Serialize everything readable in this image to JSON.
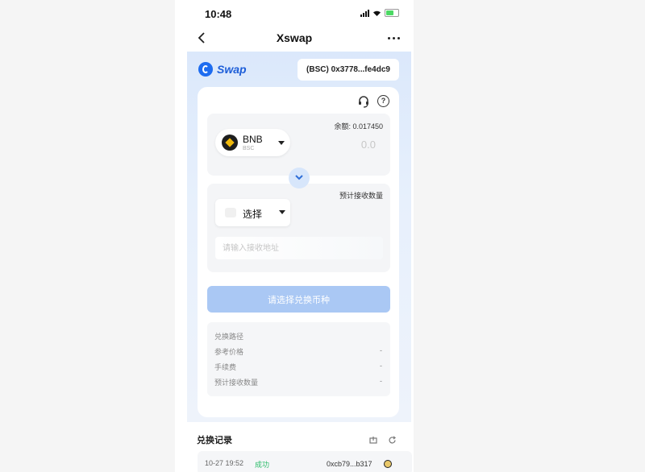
{
  "status_bar": {
    "time": "10:48"
  },
  "nav": {
    "title": "Xswap"
  },
  "header": {
    "brand": "Swap",
    "address": "(BSC) 0x3778...fe4dc9",
    "brand_color": "#1d5ed8"
  },
  "from": {
    "balance_label": "余额: 0.017450",
    "token": "BNB",
    "chain": "BSC",
    "amount": "0.0"
  },
  "to": {
    "estimate_label": "预计接收数量",
    "token_placeholder": "选择",
    "address_placeholder": "请输入接收地址"
  },
  "action": {
    "label": "请选择兑换币种",
    "color": "#aac8f4"
  },
  "info": {
    "rows": [
      {
        "label": "兑换路径",
        "value": ""
      },
      {
        "label": "参考价格",
        "value": "-"
      },
      {
        "label": "手续费",
        "value": "-"
      },
      {
        "label": "预计接收数量",
        "value": "-"
      }
    ]
  },
  "history": {
    "title": "兑换记录",
    "rows": [
      {
        "time": "10-27 19:52",
        "status": "成功",
        "hash": "0xcb79...b317"
      }
    ],
    "success_color": "#2cbc6a"
  },
  "icons": [
    "back-icon",
    "more-icon",
    "support-icon",
    "help-icon",
    "bnb-icon",
    "switch-arrow-icon",
    "filter-icon",
    "refresh-icon"
  ]
}
